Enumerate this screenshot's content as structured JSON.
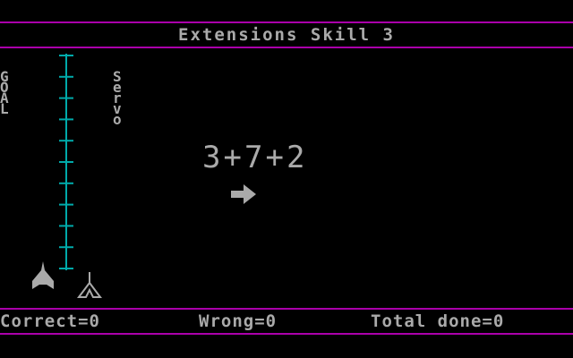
{
  "header": {
    "title": "Extensions Skill 3"
  },
  "goal_label": "GOAL",
  "servo_label": "Servo",
  "problem": {
    "operands": [
      "3",
      "+",
      "7",
      "+",
      "2"
    ]
  },
  "scale": {
    "ticks": 11
  },
  "status": {
    "correct": "Correct=0",
    "wrong": "Wrong=0",
    "total": "Total done=0"
  },
  "colors": {
    "line": "#aa00aa",
    "scale": "#00aaaa",
    "text": "#aaaaaa",
    "bg": "#000000"
  }
}
